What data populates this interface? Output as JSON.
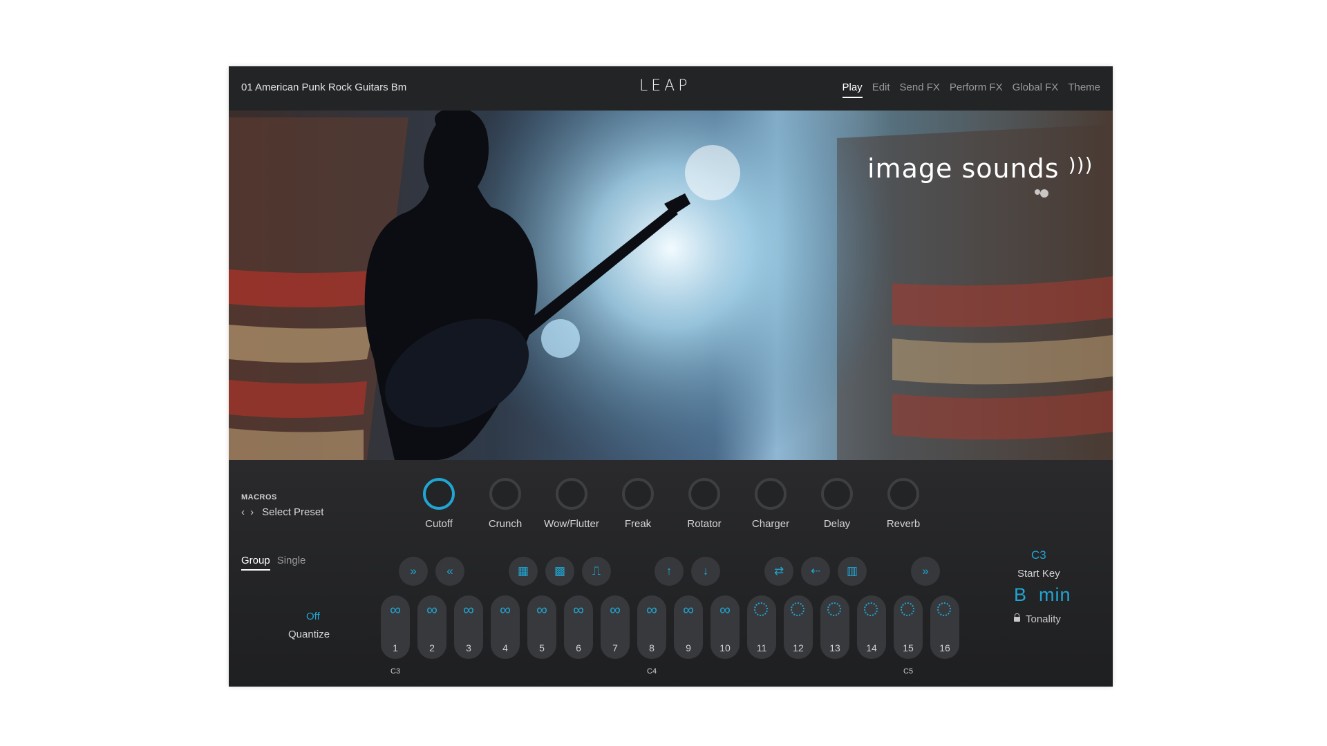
{
  "header": {
    "preset_name": "01 American Punk Rock Guitars Bm",
    "logo": "LEAP",
    "nav": [
      "Play",
      "Edit",
      "Send FX",
      "Perform FX",
      "Global FX",
      "Theme"
    ],
    "active_nav": "Play"
  },
  "hero": {
    "brand_text": "image sounds",
    "brand_icon": "wireless-signal-icon"
  },
  "macros": {
    "title": "MACROS",
    "preset_placeholder": "Select Preset",
    "knobs": [
      {
        "label": "Cutoff",
        "active": true
      },
      {
        "label": "Crunch",
        "active": false
      },
      {
        "label": "Wow/Flutter",
        "active": false
      },
      {
        "label": "Freak",
        "active": false
      },
      {
        "label": "Rotator",
        "active": false
      },
      {
        "label": "Charger",
        "active": false
      },
      {
        "label": "Delay",
        "active": false
      },
      {
        "label": "Reverb",
        "active": false
      }
    ]
  },
  "mode": {
    "tabs": [
      "Group",
      "Single"
    ],
    "active": "Group"
  },
  "quantize": {
    "value": "Off",
    "label": "Quantize"
  },
  "controls": [
    "fast-forward-icon",
    "rewind-icon",
    "pattern-icon",
    "pattern-alt-icon",
    "waveform-icon",
    "arrow-up-icon",
    "arrow-down-icon",
    "swap-icon",
    "scatter-icon",
    "bars-icon",
    "skip-icon"
  ],
  "pads": {
    "labels": [
      "1",
      "2",
      "3",
      "4",
      "5",
      "6",
      "7",
      "8",
      "9",
      "10",
      "11",
      "12",
      "13",
      "14",
      "15",
      "16"
    ],
    "looped_count": 10,
    "octave_labels": [
      "C3",
      "C4",
      "C5"
    ]
  },
  "start_key": {
    "value": "C3",
    "label": "Start Key"
  },
  "tonality": {
    "value": "B  min",
    "label": "Tonality"
  },
  "colors": {
    "accent": "#21a5d2",
    "background": "#1f2022",
    "topbar": "#232426"
  }
}
